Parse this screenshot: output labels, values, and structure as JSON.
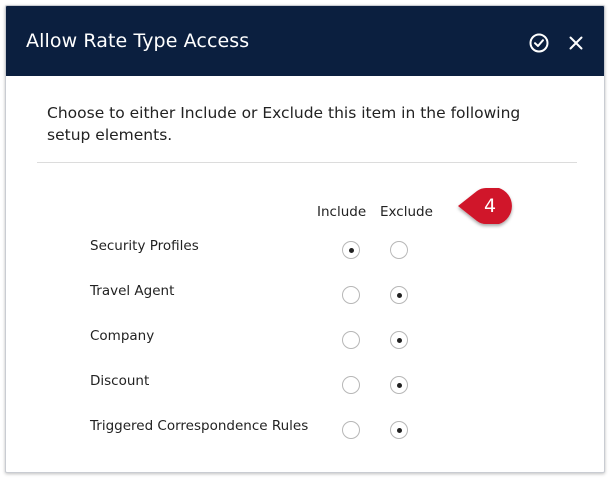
{
  "dialog": {
    "title": "Allow Rate Type Access",
    "save_icon": "check-circle-icon",
    "close_icon": "close-icon",
    "intro_text": "Choose to either Include or Exclude this item in the following setup elements."
  },
  "columns": {
    "include": "Include",
    "exclude": "Exclude"
  },
  "rows": [
    {
      "label": "Security Profiles",
      "selected": "include"
    },
    {
      "label": "Travel Agent",
      "selected": "exclude"
    },
    {
      "label": "Company",
      "selected": "exclude"
    },
    {
      "label": "Discount",
      "selected": "exclude"
    },
    {
      "label": "Triggered Correspondence Rules",
      "selected": "exclude"
    }
  ],
  "callout": {
    "number": "4",
    "color": "#d0142a"
  },
  "colors": {
    "header_bg": "#0b1f3f",
    "header_text": "#ffffff"
  }
}
